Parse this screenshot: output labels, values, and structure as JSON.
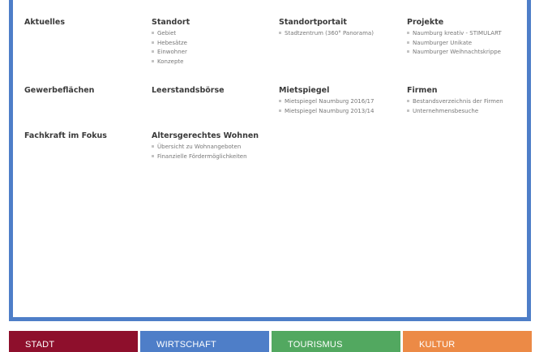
{
  "menu": {
    "aktuelles": {
      "title": "Aktuelles"
    },
    "standort": {
      "title": "Standort",
      "items": [
        "Gebiet",
        "Hebesätze",
        "Einwohner",
        "Konzepte"
      ]
    },
    "standortportrait": {
      "title": "Standortportait",
      "items": [
        "Stadtzentrum (360° Panorama)"
      ]
    },
    "projekte": {
      "title": "Projekte",
      "items": [
        "Naumburg kreativ - STIMULART",
        "Naumburger Unikate",
        "Naumburger Weihnachtskrippe"
      ]
    },
    "gewerbeflaechen": {
      "title": "Gewerbeflächen"
    },
    "leerstandsboerse": {
      "title": "Leerstandsbörse"
    },
    "mietspiegel": {
      "title": "Mietspiegel",
      "items": [
        "Mietspiegel Naumburg 2016/17",
        "Mietspiegel Naumburg 2013/14"
      ]
    },
    "firmen": {
      "title": "Firmen",
      "items": [
        "Bestandsverzeichnis der Firmen",
        "Unternehmensbesuche"
      ]
    },
    "fachkraft": {
      "title": "Fachkraft im Fokus"
    },
    "alterswohnen": {
      "title": "Altersgerechtes Wohnen",
      "items": [
        "Übersicht zu Wohnangeboten",
        "Finanzielle Fördermöglichkeiten"
      ]
    }
  },
  "nav": {
    "tabs": [
      {
        "label": "STADT",
        "color": "#8e0f2c"
      },
      {
        "label": "WIRTSCHAFT",
        "color": "#4e7ec8"
      },
      {
        "label": "TOURISMUS",
        "color": "#52a860"
      },
      {
        "label": "KULTUR",
        "color": "#ec8a46"
      }
    ]
  },
  "colors": {
    "accent": "#4e7ec8",
    "heading": "#3a3a3a",
    "subtext": "#777777"
  }
}
